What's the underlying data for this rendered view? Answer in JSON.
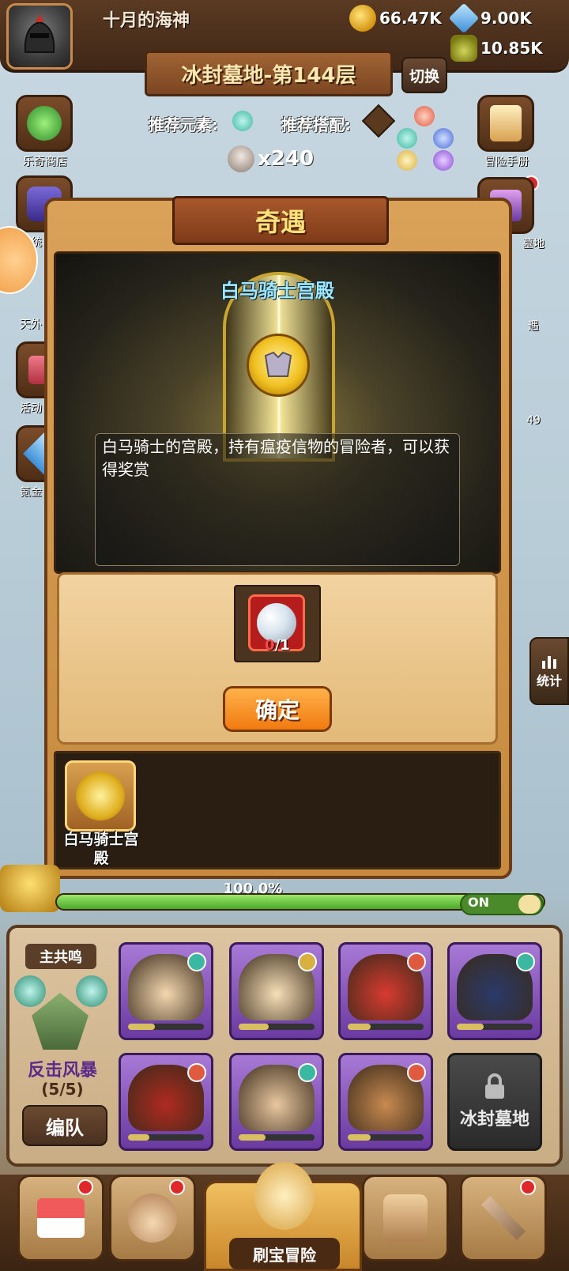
{
  "player": {
    "name": "十月的海神"
  },
  "resources": {
    "gold": "66.47K",
    "gems": "9.00K",
    "potion": "10.85K"
  },
  "stage": {
    "title": "冰封墓地-第144层",
    "switch_label": "切换"
  },
  "recommend": {
    "element_label": "推荐元素:",
    "combo_label": "推荐搭配:"
  },
  "skull": {
    "count": "x240"
  },
  "side_left": [
    {
      "label": "乐奇商店",
      "icon": "clover-icon"
    },
    {
      "label": "庆统",
      "icon": "gift-icon"
    },
    {
      "label": "天外",
      "icon": "orb-icon"
    },
    {
      "label": "活动",
      "icon": "chest-icon"
    },
    {
      "label": "氪金",
      "icon": "diamond-icon"
    }
  ],
  "side_right": [
    {
      "label": "冒险手册",
      "icon": "scroll-icon"
    },
    {
      "label": "墓地",
      "icon": "tomb-icon"
    },
    {
      "label": "遇",
      "icon": "encounter-icon"
    },
    {
      "label": "49",
      "icon": "box-icon"
    }
  ],
  "stats": {
    "label": "统计"
  },
  "dialog": {
    "title": "奇遇",
    "scene_title": "白马骑士宫殿",
    "description": "白马骑士的宫殿，持有瘟疫信物的冒险者，可以获得奖赏",
    "item": {
      "owned": "0",
      "required": "/1",
      "icon": "pearl-icon"
    },
    "confirm_label": "确定",
    "list": [
      {
        "label": "白马骑士宫殿",
        "icon": "knight-emblem-icon"
      }
    ]
  },
  "progress": {
    "percent": 100,
    "text": "100.0%",
    "toggle_label": "ON"
  },
  "team": {
    "leader_label": "主共鸣",
    "skill_name": "反击风暴",
    "skill_count": "(5/5)",
    "formation_label": "编队",
    "heroes": [
      {
        "name": "hero-samurai",
        "element": "wind",
        "color": "#f4d8b0",
        "bar": 0.35
      },
      {
        "name": "hero-king",
        "element": "light",
        "color": "#f7e0b8",
        "bar": 0.4
      },
      {
        "name": "hero-demon",
        "element": "fire",
        "color": "#d83a30",
        "bar": 0.3
      },
      {
        "name": "hero-pirate",
        "element": "wind",
        "color": "#2a3a6a",
        "bar": 0.35
      },
      {
        "name": "hero-oni",
        "element": "fire",
        "color": "#b02a20",
        "bar": 0.28
      },
      {
        "name": "hero-soldier",
        "element": "wind",
        "color": "#e8c8a0",
        "bar": 0.35
      },
      {
        "name": "hero-turban",
        "element": "fire",
        "color": "#c88a50",
        "bar": 0.3
      }
    ],
    "locked_label": "冰封墓地"
  },
  "bottom_nav": {
    "center_label": "刷宝冒险",
    "items": [
      {
        "icon": "shop-icon"
      },
      {
        "icon": "hero-icon"
      },
      {
        "icon": "adventure-icon"
      },
      {
        "icon": "backpack-icon"
      },
      {
        "icon": "forge-icon"
      }
    ]
  },
  "colors": {
    "accent": "#f07a10",
    "title_gold": "#ffe27a",
    "scene_title": "#9fe8ff",
    "alert": "#e0282a"
  }
}
